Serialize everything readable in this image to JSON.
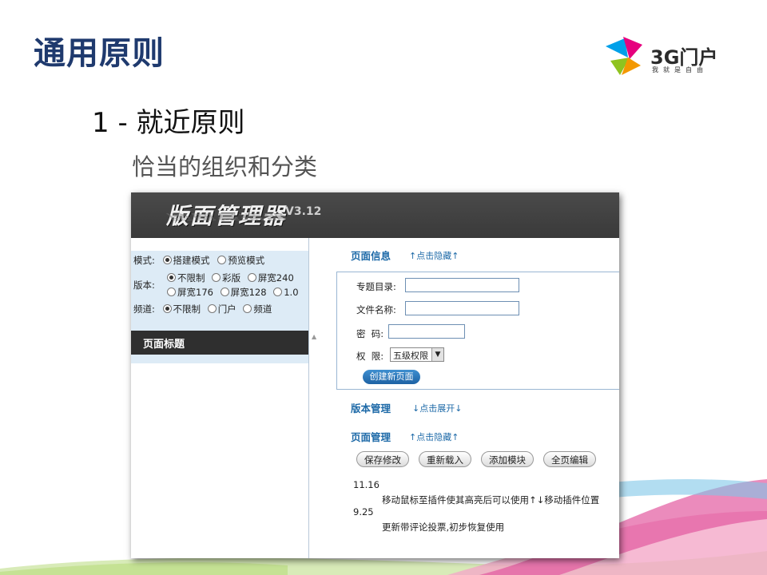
{
  "slide": {
    "title": "通用原则",
    "heading": "1 - 就近原则",
    "subheading": "恰当的组织和分类"
  },
  "logo": {
    "text": "3G门户",
    "slogan": "我就是自由",
    "colors": [
      "#e6007e",
      "#00a0e9",
      "#8fc31f",
      "#f39800"
    ]
  },
  "app": {
    "title": "版面管理器",
    "version": "V3.12",
    "options": {
      "mode": {
        "label": "模式:",
        "choices": [
          {
            "text": "搭建模式",
            "selected": true
          },
          {
            "text": "预览模式",
            "selected": false
          }
        ]
      },
      "version": {
        "label": "版本:",
        "choices": [
          {
            "text": "不限制",
            "selected": true
          },
          {
            "text": "彩版",
            "selected": false
          },
          {
            "text": "屏宽240",
            "selected": false
          },
          {
            "text": "屏宽176",
            "selected": false
          },
          {
            "text": "屏宽128",
            "selected": false
          },
          {
            "text": "1.0",
            "selected": false
          }
        ]
      },
      "channel": {
        "label": "频道:",
        "choices": [
          {
            "text": "不限制",
            "selected": true
          },
          {
            "text": "门户",
            "selected": false
          },
          {
            "text": "频道",
            "selected": false
          }
        ]
      }
    },
    "left_list_title": "页面标题",
    "page_info": {
      "title": "页面信息",
      "toggle": "↑点击隐藏↑",
      "fields": {
        "topic_dir": "专题目录:",
        "file_name": "文件名称:",
        "password": "密  码:",
        "permission": "权  限:"
      },
      "permission_value": "五级权限",
      "create_button": "创建新页面"
    },
    "version_mgmt": {
      "title": "版本管理",
      "toggle": "↓点击展开↓"
    },
    "page_mgmt": {
      "title": "页面管理",
      "toggle": "↑点击隐藏↑",
      "buttons": {
        "save": "保存修改",
        "reload": "重新载入",
        "add_module": "添加模块",
        "full_edit": "全页编辑"
      }
    },
    "changelog": [
      {
        "date": "11.16",
        "text": "移动鼠标至插件使其高亮后可以使用↑↓移动插件位置"
      },
      {
        "date": "9.25",
        "text": "更新带评论投票,初步恢复使用"
      }
    ]
  }
}
